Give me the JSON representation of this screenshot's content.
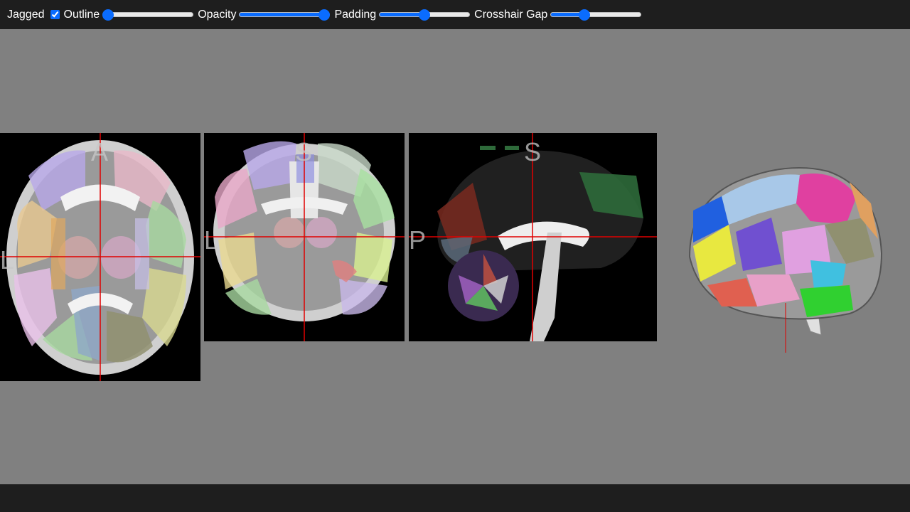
{
  "toolbar": {
    "jagged_label": "Jagged",
    "jagged_checked": true,
    "outline_label": "Outline",
    "outline_value": 0,
    "opacity_label": "Opacity",
    "opacity_value": 1.0,
    "padding_label": "Padding",
    "padding_value": 0.5,
    "crosshair_gap_label": "Crosshair Gap",
    "crosshair_gap_value": 0.35
  },
  "views": {
    "axial": {
      "top": "A",
      "left": "L"
    },
    "coronal": {
      "top": "S",
      "left": "L"
    },
    "sagittal": {
      "top": "S",
      "left": "P"
    }
  },
  "colors": {
    "toolbar_bg": "#1e1e1e",
    "canvas_bg": "#808080",
    "crosshair": "#e00000",
    "slider_accent": "#0a6cff"
  },
  "icons": [
    "checkbox-icon",
    "slider-thumb-icon",
    "brain-render-icon"
  ]
}
